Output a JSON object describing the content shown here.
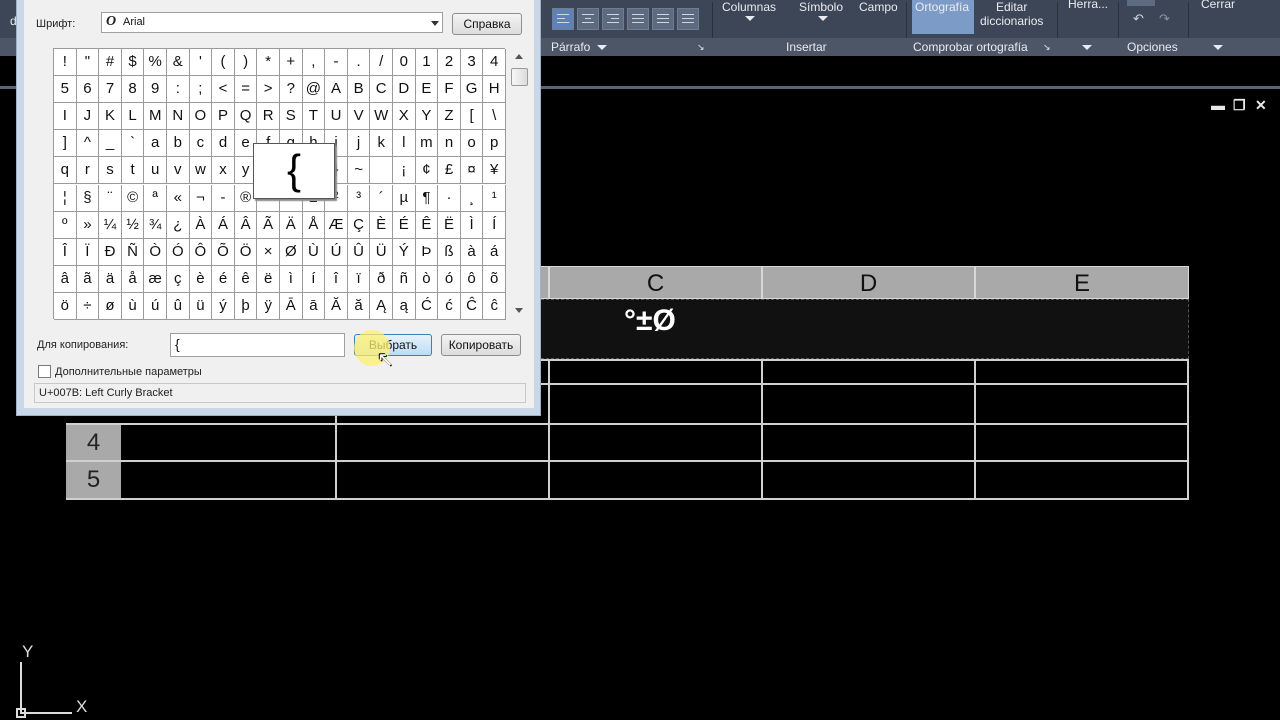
{
  "ribbon": {
    "columnas": "Columnas",
    "simbolo": "Símbolo",
    "campo": "Campo",
    "ortografia": "Ortografía",
    "editar_line1": "Editar",
    "editar_line2": "diccionarios",
    "herra": "Herra...",
    "cerrar": "Cerrar",
    "panel_parrafo": "Párrafo",
    "panel_insertar": "Insertar",
    "panel_comprobar": "Comprobar ortografía",
    "panel_opciones": "Opciones",
    "left_cut_text": "d"
  },
  "dialog": {
    "font_label": "Шрифт:",
    "font_value": "Arial",
    "help_button": "Справка",
    "chars": [
      "!",
      "\"",
      "#",
      "$",
      "%",
      "&",
      "'",
      "(",
      ")",
      "*",
      "+",
      ",",
      "-",
      ".",
      "/",
      "0",
      "1",
      "2",
      "3",
      "4",
      "5",
      "6",
      "7",
      "8",
      "9",
      ":",
      ";",
      "<",
      "=",
      ">",
      "?",
      "@",
      "A",
      "B",
      "C",
      "D",
      "E",
      "F",
      "G",
      "H",
      "I",
      "J",
      "K",
      "L",
      "M",
      "N",
      "O",
      "P",
      "Q",
      "R",
      "S",
      "T",
      "U",
      "V",
      "W",
      "X",
      "Y",
      "Z",
      "[",
      "\\",
      "]",
      "^",
      "_",
      "`",
      "a",
      "b",
      "c",
      "d",
      "e",
      "f",
      "g",
      "h",
      "i",
      "j",
      "k",
      "l",
      "m",
      "n",
      "o",
      "p",
      "q",
      "r",
      "s",
      "t",
      "u",
      "v",
      "w",
      "x",
      "y",
      "z",
      "{",
      "|",
      "}",
      "~",
      " ",
      "¡",
      "¢",
      "£",
      "¤",
      "¥",
      "¦",
      "§",
      "¨",
      "©",
      "ª",
      "«",
      "¬",
      "-",
      "®",
      "¯",
      "°",
      "±",
      "²",
      "³",
      "´",
      "µ",
      "¶",
      "·",
      "¸",
      "¹",
      "º",
      "»",
      "¼",
      "½",
      "¾",
      "¿",
      "À",
      "Á",
      "Â",
      "Ã",
      "Ä",
      "Å",
      "Æ",
      "Ç",
      "È",
      "É",
      "Ê",
      "Ë",
      "Ì",
      "Í",
      "Î",
      "Ï",
      "Ð",
      "Ñ",
      "Ò",
      "Ó",
      "Ô",
      "Õ",
      "Ö",
      "×",
      "Ø",
      "Ù",
      "Ú",
      "Û",
      "Ü",
      "Ý",
      "Þ",
      "ß",
      "à",
      "á",
      "â",
      "ã",
      "ä",
      "å",
      "æ",
      "ç",
      "è",
      "é",
      "ê",
      "ë",
      "ì",
      "í",
      "î",
      "ï",
      "ð",
      "ñ",
      "ò",
      "ó",
      "ô",
      "õ",
      "ö",
      "÷",
      "ø",
      "ù",
      "ú",
      "û",
      "ü",
      "ý",
      "þ",
      "ÿ",
      "Ā",
      "ā",
      "Ă",
      "ă",
      "Ą",
      "ą",
      "Ć",
      "ć",
      "Ĉ",
      "ĉ"
    ],
    "zoom_char": "{",
    "copy_label": "Для копирования:",
    "copy_value": "{",
    "select_button": "Выбрать",
    "copy_button": "Копировать",
    "advanced_label": "Дополнительные параметры",
    "status": "U+007B: Left Curly Bracket"
  },
  "table": {
    "col_c": "C",
    "col_d": "D",
    "col_e": "E",
    "title_text": "°±Ø",
    "row4": "4",
    "row5": "5"
  },
  "ucs": {
    "y": "Y",
    "x": "X"
  },
  "viewport_controls": {
    "minimize": "▬",
    "restore": "❐",
    "close": "✕"
  }
}
